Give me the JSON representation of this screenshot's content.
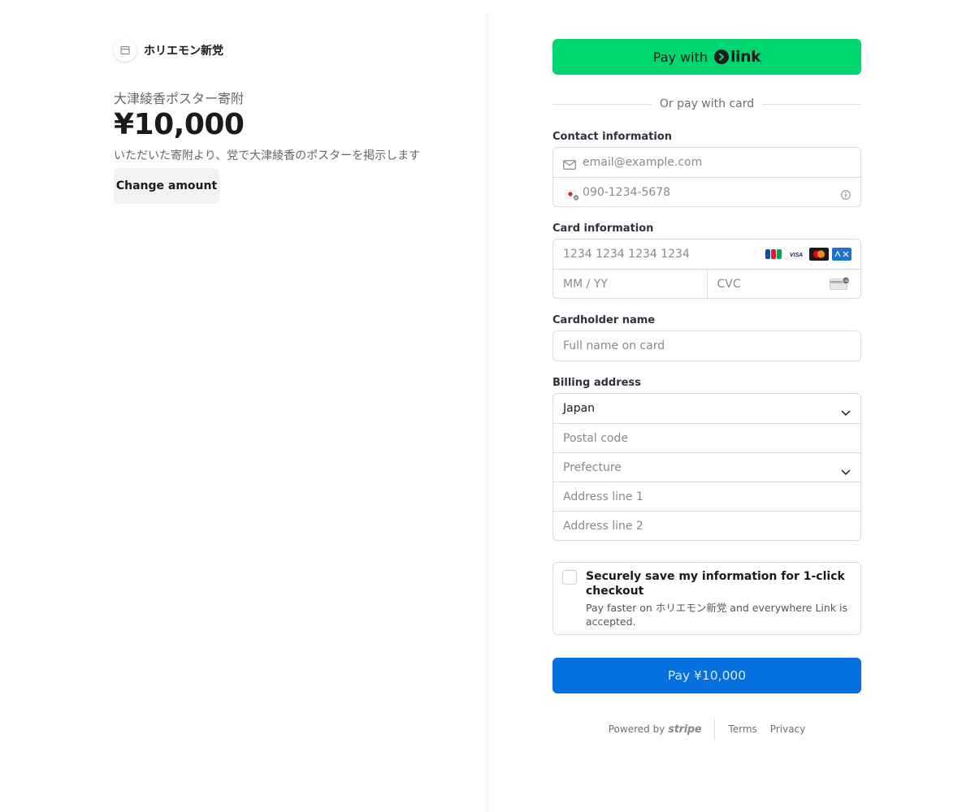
{
  "merchant": {
    "name": "ホリエモン新党",
    "logo_icon": "store-icon"
  },
  "product": {
    "name": "大津綾香ポスター寄附",
    "amount": "¥10,000",
    "description": "いただいた寄附より、党で大津綾香のポスターを掲示します",
    "change_amount_label": "Change amount"
  },
  "link_button": {
    "pay_with": "Pay with",
    "link_word": "link",
    "color": "#00d66f"
  },
  "divider_text": "Or pay with card",
  "contact": {
    "label": "Contact information",
    "email_placeholder": "email@example.com",
    "phone_placeholder": "090-1234-5678"
  },
  "card": {
    "label": "Card information",
    "number_placeholder": "1234 1234 1234 1234",
    "expiry_placeholder": "MM / YY",
    "cvc_placeholder": "CVC",
    "brands": [
      "JCB",
      "VISA",
      "Mastercard",
      "AMEX"
    ]
  },
  "cardholder": {
    "label": "Cardholder name",
    "placeholder": "Full name on card"
  },
  "billing": {
    "label": "Billing address",
    "country": "Japan",
    "postal_placeholder": "Postal code",
    "prefecture_placeholder": "Prefecture",
    "address1_placeholder": "Address line 1",
    "address2_placeholder": "Address line 2"
  },
  "save_info": {
    "title": "Securely save my information for 1-click checkout",
    "subtitle": "Pay faster on ホリエモン新党 and everywhere Link is accepted."
  },
  "pay_button": {
    "label": "Pay ¥10,000",
    "color": "#0570de"
  },
  "footer": {
    "powered_by": "Powered by",
    "stripe": "stripe",
    "terms": "Terms",
    "privacy": "Privacy"
  }
}
